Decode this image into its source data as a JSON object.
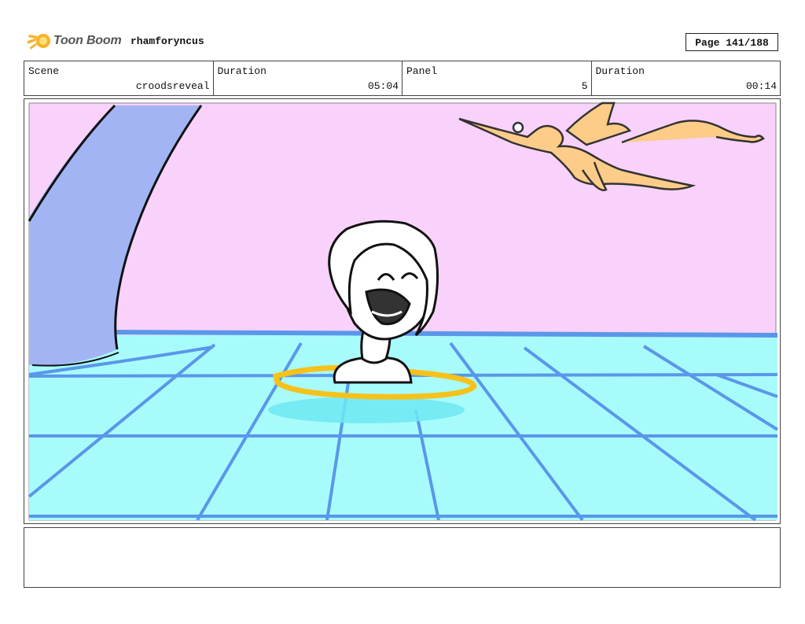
{
  "header": {
    "brand": "Toon Boom",
    "project": "rhamforyncus",
    "page": "Page 141/188"
  },
  "info": {
    "scene_label": "Scene",
    "scene_value": "croodsreveal",
    "scene_duration_label": "Duration",
    "scene_duration_value": "05:04",
    "panel_label": "Panel",
    "panel_value": "5",
    "panel_duration_label": "Duration",
    "panel_duration_value": "00:14"
  },
  "notes": {
    "text": ""
  },
  "colors": {
    "sky": "#f8d2fa",
    "pool": "#a8fbfb",
    "grid": "#5a97ea",
    "pillar": "#a3b4f5",
    "ring": "#f6c21a",
    "creature": "#fccc88"
  },
  "icons": [
    "toon-boom-logo-icon"
  ]
}
